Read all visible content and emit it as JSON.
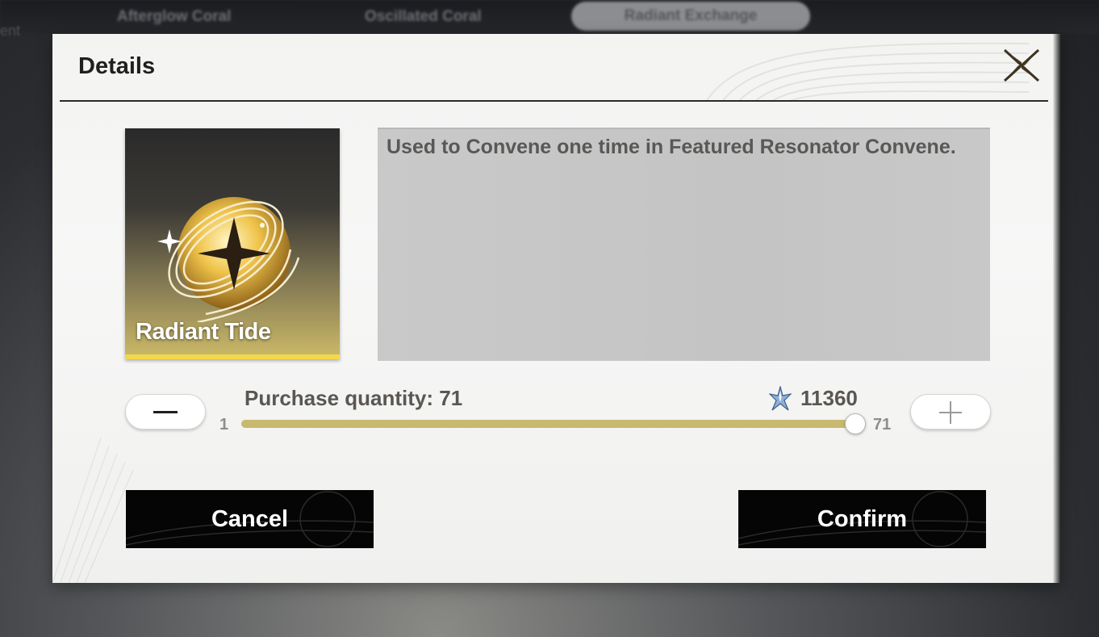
{
  "background": {
    "tabs": [
      "Afterglow Coral",
      "Oscillated Coral",
      "Radiant Exchange"
    ],
    "left_stub": "ent"
  },
  "dialog": {
    "title": "Details",
    "close_icon": "close-x-icon"
  },
  "item": {
    "name": "Radiant Tide",
    "description": "Used to Convene one time in Featured Resonator Convene.",
    "rarity_color": "#f2d84a"
  },
  "purchase": {
    "label": "Purchase quantity: 71",
    "min": "1",
    "max": "71",
    "quantity": 71,
    "cost_icon": "star-crystal-icon",
    "cost": "11360",
    "minus_icon": "minus-icon",
    "plus_icon": "plus-icon"
  },
  "actions": {
    "cancel_label": "Cancel",
    "confirm_label": "Confirm"
  },
  "colors": {
    "accent": "#c9b96e",
    "button_bg": "#050505"
  }
}
